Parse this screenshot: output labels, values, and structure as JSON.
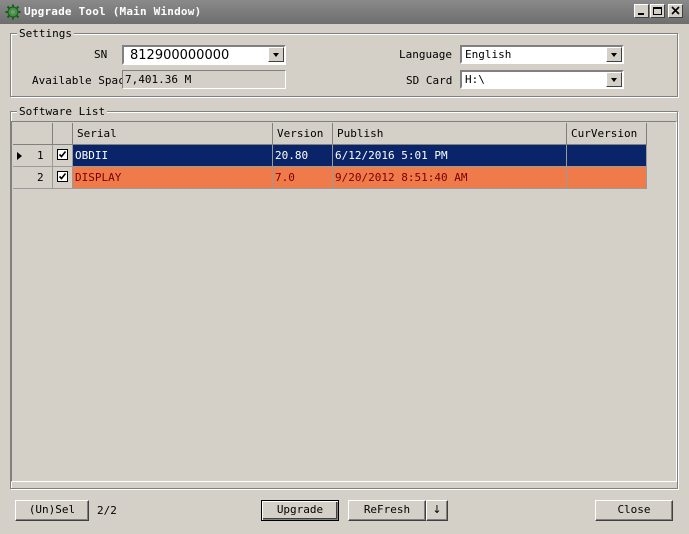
{
  "window": {
    "title": "Upgrade Tool (Main Window)"
  },
  "settings": {
    "group_label": "Settings",
    "sn_label": "SN",
    "sn_value": "812900000000",
    "available_space_label": "Available Space",
    "available_space_value": "7,401.36 M",
    "language_label": "Language",
    "language_value": "English",
    "sd_card_label": "SD Card",
    "sd_card_value": "H:\\"
  },
  "software_list": {
    "group_label": "Software List",
    "columns": [
      "Serial",
      "Version",
      "Publish",
      "CurVersion"
    ],
    "rows": [
      {
        "index": "1",
        "serial": "OBDII",
        "version": "20.80",
        "publish": "6/12/2016 5:01 PM",
        "cur_version": ""
      },
      {
        "index": "2",
        "serial": "DISPLAY",
        "version": "7.0",
        "publish": "9/20/2012 8:51:40 AM",
        "cur_version": ""
      }
    ]
  },
  "bottom": {
    "unsel_label": "(Un)Sel",
    "count": "2/2",
    "upgrade_label": "Upgrade",
    "refresh_label": "ReFresh",
    "refresh_dropdown_glyph": "↓",
    "close_label": "Close"
  },
  "colors": {
    "selected_row": "#0a246a",
    "highlight_row": "#ef7a4a"
  }
}
